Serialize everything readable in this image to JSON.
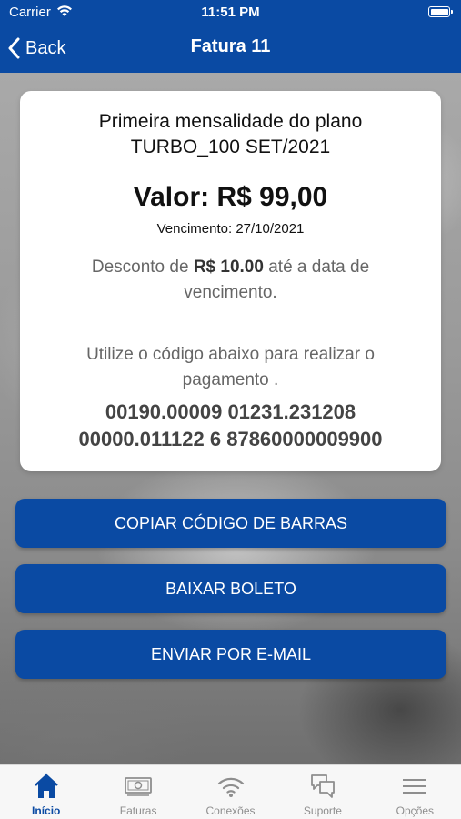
{
  "status_bar": {
    "carrier": "Carrier",
    "time": "11:51 PM"
  },
  "nav": {
    "back_label": "Back",
    "title": "Fatura 11"
  },
  "invoice": {
    "description_line1": "Primeira mensalidade do plano",
    "description_line2": "TURBO_100 SET/2021",
    "valor": "Valor: R$ 99,00",
    "vencimento": "Vencimento: 27/10/2021",
    "desconto_prefix": "Desconto de",
    "desconto_amount": "R$ 10.00",
    "desconto_suffix": "até a data de vencimento.",
    "instrucao": "Utilize o código abaixo para realizar o pagamento .",
    "codigo_line1": "00190.00009 01231.231208",
    "codigo_line2": "00000.011122 6 87860000009900"
  },
  "actions": {
    "copy_barcode": "COPIAR CÓDIGO DE BARRAS",
    "download_boleto": "BAIXAR BOLETO",
    "send_email": "ENVIAR POR E-MAIL"
  },
  "tabbar": {
    "items": [
      {
        "label": "Início",
        "icon": "home-icon",
        "active": true
      },
      {
        "label": "Faturas",
        "icon": "banknote-icon",
        "active": false
      },
      {
        "label": "Conexões",
        "icon": "wifi-icon",
        "active": false
      },
      {
        "label": "Suporte",
        "icon": "chat-icon",
        "active": false
      },
      {
        "label": "Opções",
        "icon": "menu-icon",
        "active": false
      }
    ]
  },
  "colors": {
    "brand_blue": "#0a4aa3",
    "tab_inactive": "#8e8e8e"
  }
}
